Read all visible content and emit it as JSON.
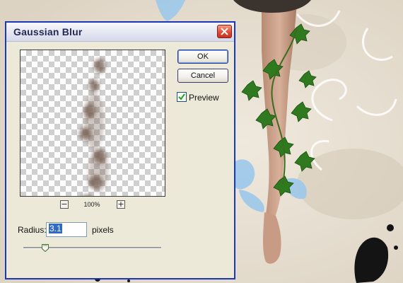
{
  "dialog": {
    "title": "Gaussian Blur",
    "ok_label": "OK",
    "cancel_label": "Cancel",
    "preview_label": "Preview",
    "preview_checked": true,
    "zoom_minus": "−",
    "zoom_plus": "+",
    "zoom_level": "100%",
    "radius_label": "Radius:",
    "radius_value": "3.1",
    "units_label": "pixels",
    "slider_fraction": 0.16
  },
  "icons": {
    "close": "close-icon",
    "check": "checkmark-icon"
  },
  "colors": {
    "dialog_bg": "#ece9d8",
    "close_red": "#e24d35",
    "selection_blue": "#316ac5",
    "ivy_green": "#2f7a1f",
    "splash_blue": "#9cc8ea"
  }
}
